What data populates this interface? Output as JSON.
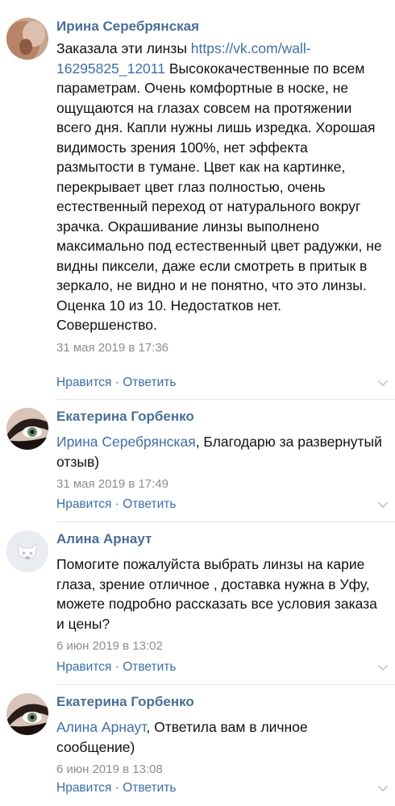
{
  "comments": [
    {
      "author": "Ирина Серебрянская",
      "prefix": "Заказала эти линзы ",
      "link": "https://vk.com/wall-16295825_12011",
      "text": " Высококачественные по всем параметрам. Очень комфортные в носке, не ощущаются на глазах совсем на протяжении всего дня. Капли нужны лишь изредка. Хорошая видимость зрения 100%, нет эффекта размытости в тумане. Цвет как на картинке, перекрывает цвет глаз полностью, очень естественный переход от натурального вокруг зрачка. Окрашивание линзы выполнено максимально под естественный цвет радужки, не видны пиксели, даже если смотреть в притык в зеркало, не видно и не понятно, что это линзы.\nОценка 10 из 10. Недостатков нет. Совершенство.",
      "date": "31 мая 2019 в 17:36",
      "like": "Нравится",
      "sep": " · ",
      "reply": "Ответить",
      "avatar": "photo-skin"
    },
    {
      "author": "Екатерина Горбенко",
      "mention": "Ирина Серебрянская",
      "text": ", Благодарю за развернутый отзыв)",
      "date": "31 мая 2019 в 17:49",
      "like": "Нравится",
      "sep": " · ",
      "reply": "Ответить",
      "avatar": "photo-eye"
    },
    {
      "author": "Алина Арнаут",
      "text": "Помогите пожалуйста выбрать линзы на карие глаза, зрение отличное , доставка нужна в Уфу, можете подробно рассказать все условия заказа и цены?",
      "date": "6 июн 2019 в 13:02",
      "like": "Нравится",
      "sep": " · ",
      "reply": "Ответить",
      "avatar": "default-dog-avatar"
    },
    {
      "author": "Екатерина Горбенко",
      "mention": "Алина Арнаут",
      "text": ", Ответила вам в личное сообщение)",
      "date": "6 июн 2019 в 13:08",
      "like": "Нравится",
      "sep": " · ",
      "reply": "Ответить",
      "avatar": "photo-eye"
    }
  ],
  "colors": {
    "author": "#4a6f96",
    "link": "#3f6fa8",
    "action": "#3a6ea5",
    "date": "#8a8d92",
    "divider": "#e4e6ea"
  }
}
